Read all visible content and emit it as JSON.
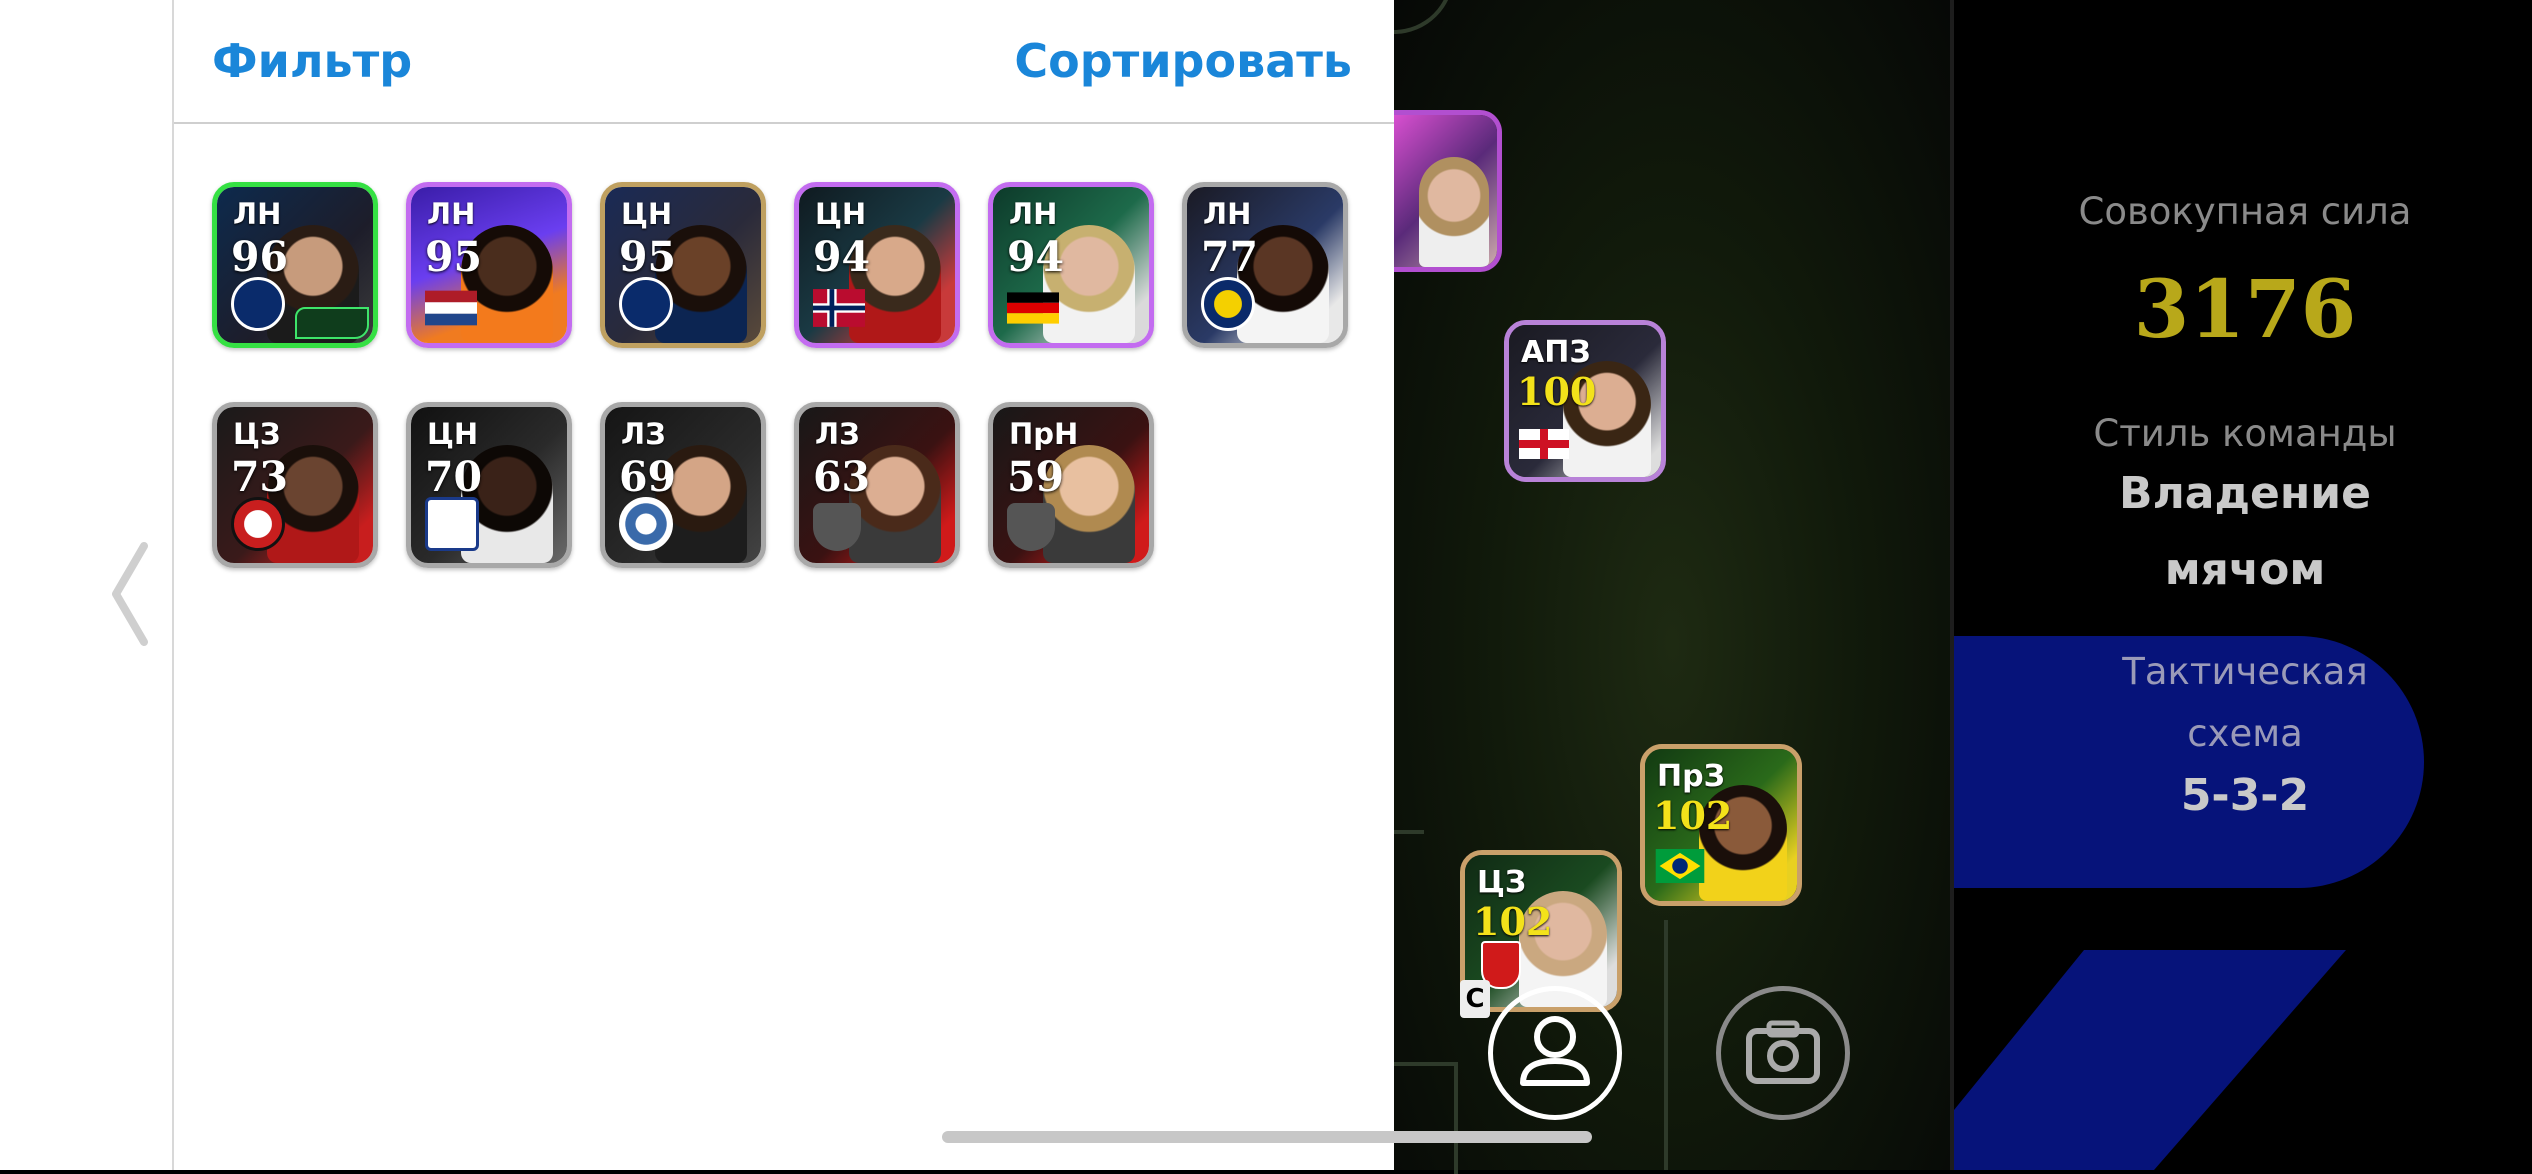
{
  "header": {
    "filter_label": "Фильтр",
    "sort_label": "Сортировать"
  },
  "players": [
    {
      "pos": "ЛН",
      "ovr": "96"
    },
    {
      "pos": "ЛН",
      "ovr": "95"
    },
    {
      "pos": "ЦН",
      "ovr": "95"
    },
    {
      "pos": "ЦН",
      "ovr": "94"
    },
    {
      "pos": "ЛН",
      "ovr": "94"
    },
    {
      "pos": "ЛН",
      "ovr": "77"
    },
    {
      "pos": "ЦЗ",
      "ovr": "73"
    },
    {
      "pos": "ЦН",
      "ovr": "70"
    },
    {
      "pos": "ЛЗ",
      "ovr": "69"
    },
    {
      "pos": "ЛЗ",
      "ovr": "63"
    },
    {
      "pos": "ПрН",
      "ovr": "59"
    }
  ],
  "pitch_players": [
    {
      "pos": "АПЗ",
      "ovr": "100"
    },
    {
      "pos": "ПрЗ",
      "ovr": "102"
    },
    {
      "pos": "ЦЗ",
      "ovr": "102"
    }
  ],
  "captain_mark": "C",
  "team_info": {
    "strength_label": "Совокупная сила",
    "strength_value": "3176",
    "style_label": "Стиль команды",
    "style_value_line1": "Владение",
    "style_value_line2": "мячом",
    "formation_label_line1": "Тактическая",
    "formation_label_line2": "схема",
    "formation_value": "5-3-2"
  },
  "colors": {
    "accent_blue": "#1a86d9",
    "strength_yellow": "#b8a81a",
    "formation_pill": "#06137a"
  },
  "icons": {
    "back": "chevron-left-icon",
    "player_select": "person-icon",
    "screenshot": "camera-icon"
  }
}
